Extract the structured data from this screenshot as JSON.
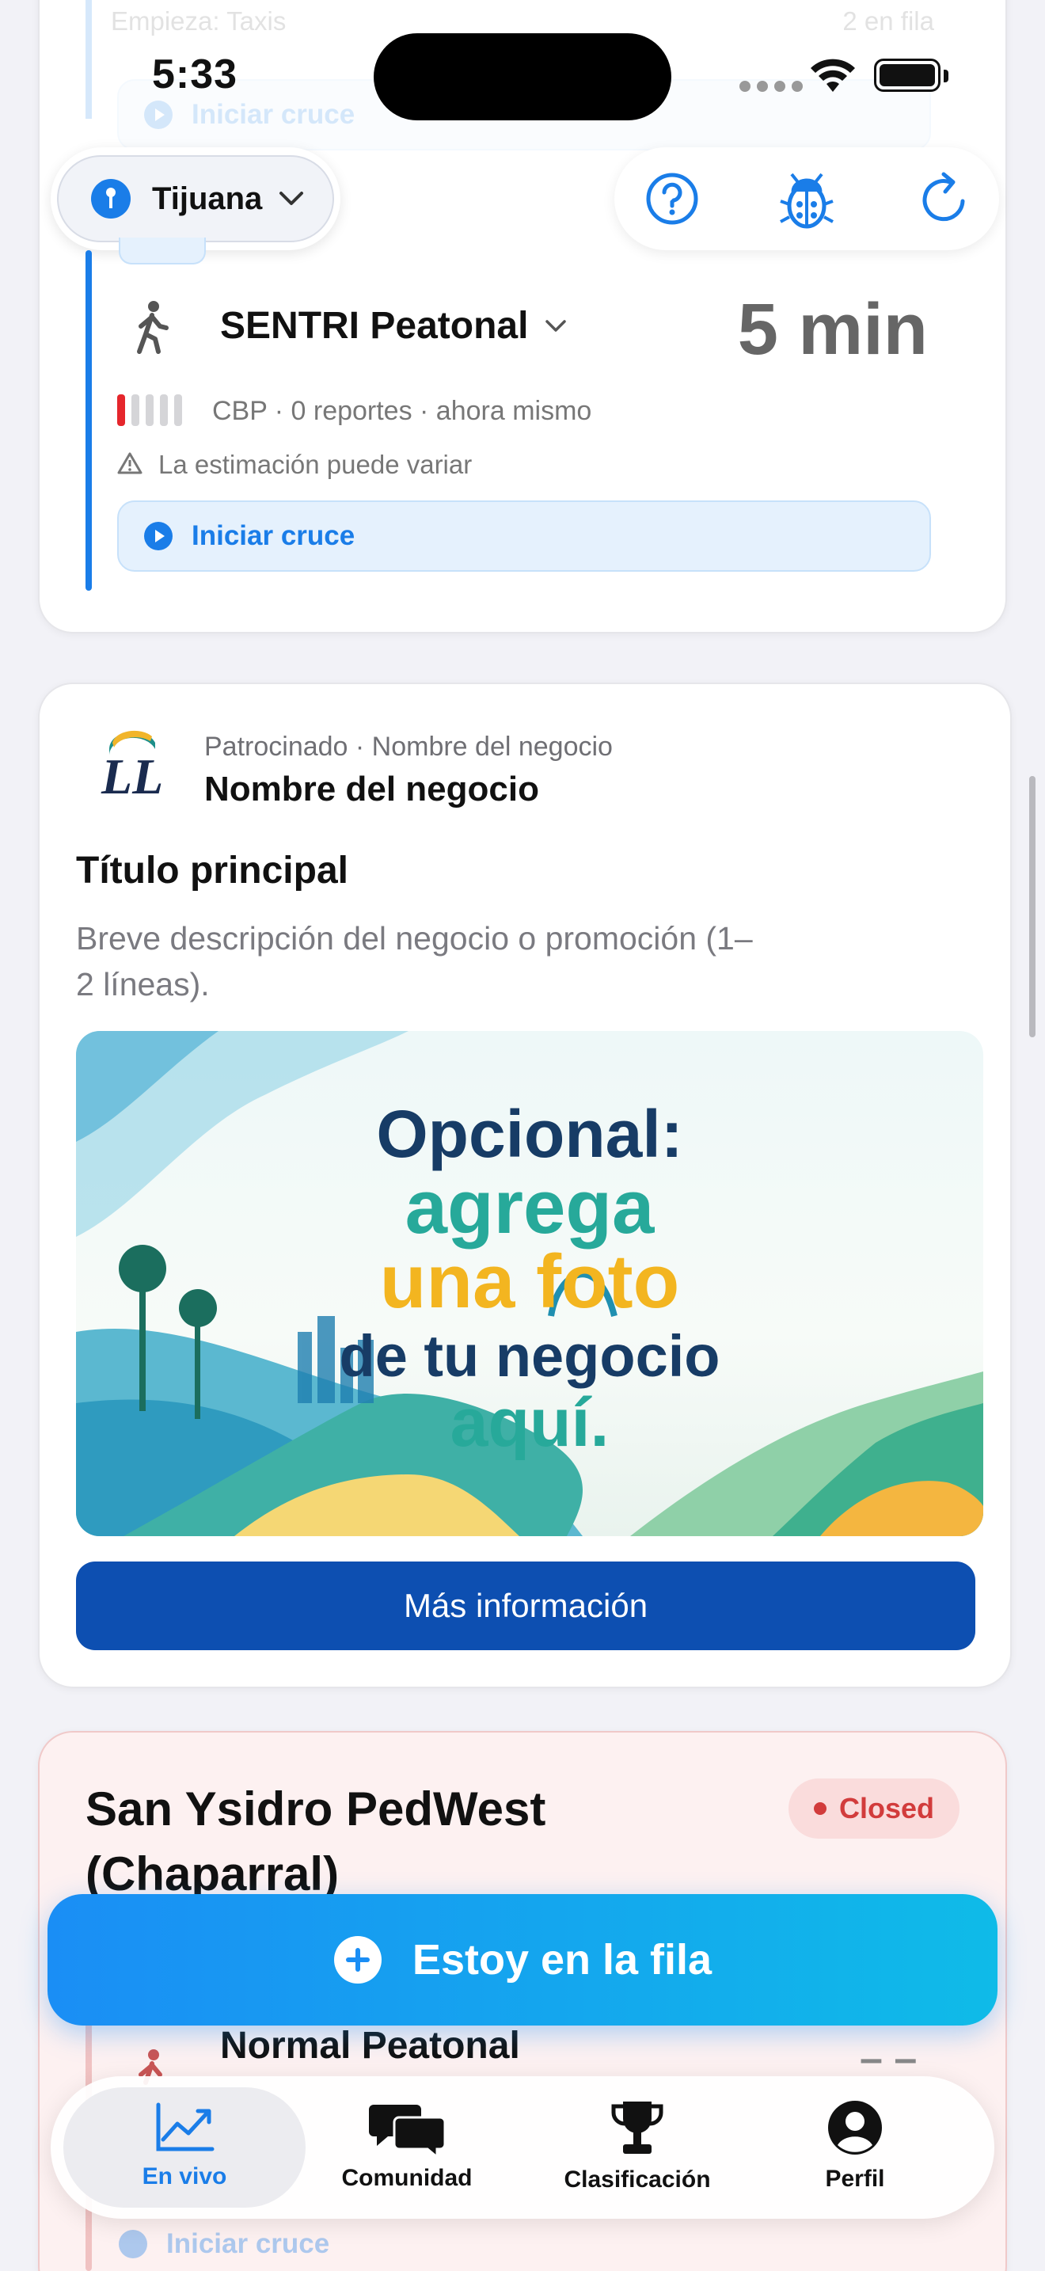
{
  "status_bar": {
    "time": "5:33"
  },
  "top_faded": {
    "starts_label": "Empieza: Taxis",
    "queue_label": "2 en fila",
    "start_label": "Iniciar cruce"
  },
  "location_button": {
    "label": "Tijuana"
  },
  "top_actions": {
    "help": "help-icon",
    "bug": "bug-icon",
    "refresh": "refresh-icon"
  },
  "crossing_card": {
    "lane_name": "SENTRI Peatonal",
    "wait_time": "5 min",
    "meta": "CBP · 0 reportes · ahora mismo",
    "warning": "La estimación puede variar",
    "start_label": "Iniciar cruce",
    "signal_level": 0.2
  },
  "sponsored_card": {
    "sponsor_line": "Patrocinado · Nombre del negocio",
    "business_name": "Nombre del negocio",
    "title": "Título principal",
    "description_line1": "Breve descripción del negocio o promoción (1–",
    "description_line2": "2 líneas).",
    "image_line1": "Opcional:",
    "image_line2": "agrega",
    "image_line3": "una foto",
    "image_line4": "de tu negocio",
    "image_line5": "aquí.",
    "cta_label": "Más información",
    "logo_text": "LL"
  },
  "port_card": {
    "title_line1": "San Ysidro PedWest",
    "title_line2": "(Chaparral)",
    "status_badge": "Closed",
    "lane_name": "Normal Peatonal",
    "wait_placeholder": "– –",
    "start_label": "Iniciar cruce"
  },
  "queue_button": {
    "label": "Estoy en la fila"
  },
  "tab_bar": {
    "tabs": [
      {
        "label": "En vivo",
        "icon": "chart-line-icon",
        "active": true
      },
      {
        "label": "Comunidad",
        "icon": "chat-bubbles-icon",
        "active": false
      },
      {
        "label": "Clasificación",
        "icon": "trophy-icon",
        "active": false
      },
      {
        "label": "Perfil",
        "icon": "person-circle-icon",
        "active": false
      }
    ]
  },
  "colors": {
    "accent": "#1a7de8",
    "cta": "#0d4fb1",
    "closed": "#d23c3c",
    "queue_button": "#1aa3f0"
  }
}
